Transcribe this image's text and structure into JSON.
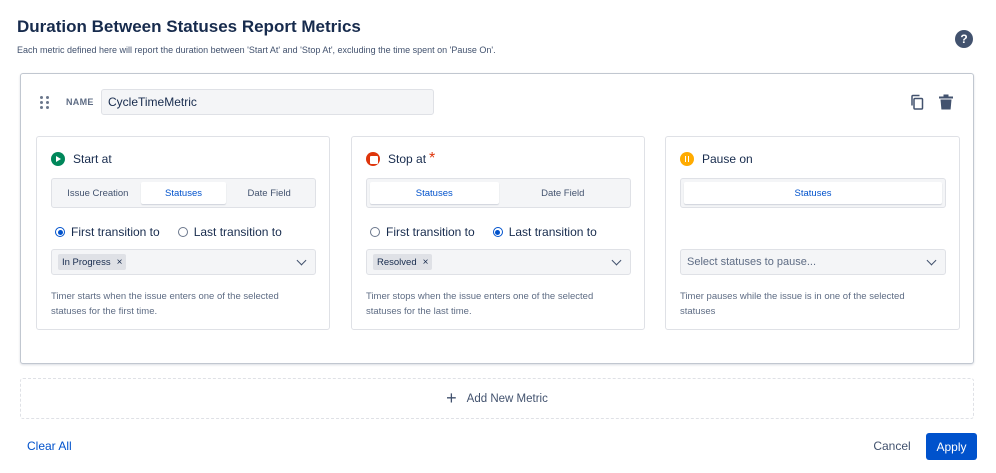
{
  "header": {
    "title": "Duration Between Statuses Report Metrics",
    "subtitle": "Each metric defined here will report the duration between 'Start At' and 'Stop At', excluding the time spent on 'Pause On'.",
    "help_glyph": "?"
  },
  "metric": {
    "name_label": "NAME",
    "name_value": "CycleTimeMetric",
    "start": {
      "title": "Start at",
      "tabs": [
        "Issue Creation",
        "Statuses",
        "Date Field"
      ],
      "active_tab": "Statuses",
      "radio_first": "First transition to",
      "radio_last": "Last transition to",
      "selected_radio": "first",
      "tags": [
        "In Progress"
      ],
      "help": "Timer starts when the issue enters one of the selected statuses for the first time."
    },
    "stop": {
      "title": "Stop at",
      "required_mark": "*",
      "tabs": [
        "Statuses",
        "Date Field"
      ],
      "active_tab": "Statuses",
      "radio_first": "First transition to",
      "radio_last": "Last transition to",
      "selected_radio": "last",
      "tags": [
        "Resolved"
      ],
      "help": "Timer stops when the issue enters one of the selected statuses for the last time."
    },
    "pause": {
      "title": "Pause on",
      "tabs": [
        "Statuses"
      ],
      "active_tab": "Statuses",
      "placeholder": "Select statuses to pause...",
      "help": "Timer pauses while the issue is in one of the selected statuses"
    }
  },
  "add_metric": {
    "label": "Add New Metric",
    "icon_glyph": "+"
  },
  "footer": {
    "clear_all": "Clear All",
    "cancel": "Cancel",
    "apply": "Apply"
  },
  "tag_remove_glyph": "×",
  "colors": {
    "primary": "#0052cc",
    "start_icon": "#00875a",
    "stop_icon": "#de350b",
    "pause_icon": "#ffab00"
  },
  "icons": {
    "start": "play-circle-icon",
    "stop": "stop-circle-icon",
    "pause": "pause-circle-icon",
    "copy": "copy-icon",
    "delete": "trash-icon",
    "drag": "drag-handle-icon",
    "help": "help-icon"
  }
}
